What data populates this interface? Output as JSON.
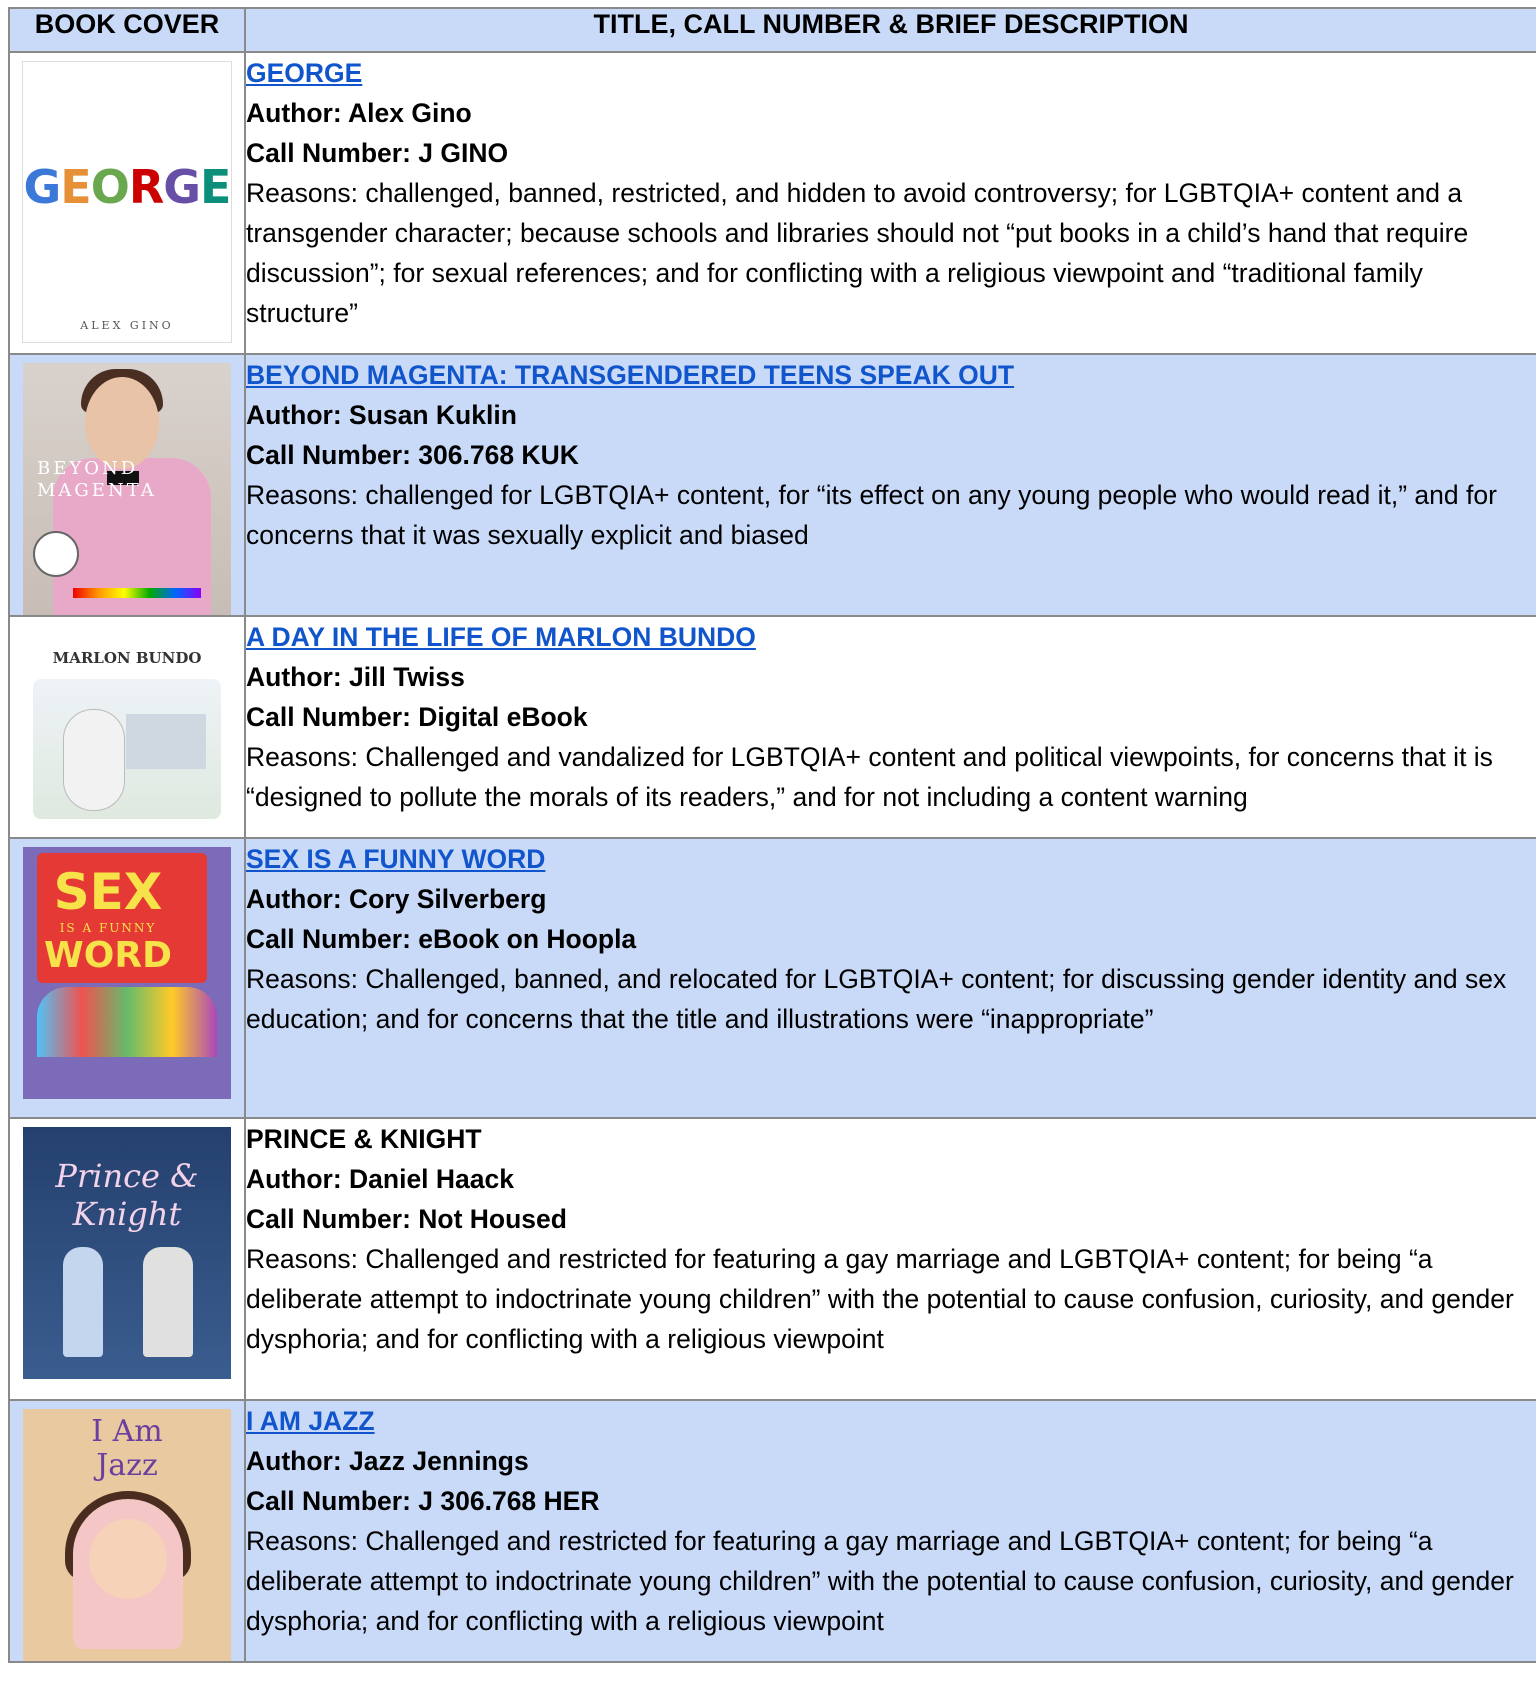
{
  "table": {
    "header_cover": "BOOK COVER",
    "header_desc": "TITLE, CALL NUMBER & BRIEF DESCRIPTION"
  },
  "books": [
    {
      "title": "GEORGE",
      "author": "Author: Alex Gino",
      "call": "Call Number: J GINO",
      "reasons": "Reasons: challenged, banned, restricted, and hidden to avoid controversy; for LGBTQIA+ content and a transgender character; because schools and libraries should not “put books in a child’s hand that require discussion”; for sexual references; and for conflicting with a religious viewpoint and “traditional family structure”",
      "cover_title": "GEORGE",
      "cover_author": "ALEX GINO"
    },
    {
      "title": "BEYOND MAGENTA: TRANSGENDERED TEENS SPEAK OUT",
      "author": "Author: Susan Kuklin",
      "call": "Call Number: 306.768 KUK",
      "reasons": "Reasons: challenged for LGBTQIA+ content, for “its effect on any young people who would read it,” and for concerns that it was sexually explicit and biased",
      "cover_line1": "BEYOND",
      "cover_line2": "MAGENTA"
    },
    {
      "title": "A DAY IN THE LIFE OF MARLON BUNDO",
      "author": "Author: Jill Twiss",
      "call": "Call Number: Digital eBook",
      "reasons": "Reasons: Challenged and vandalized for LGBTQIA+ content and political viewpoints, for concerns that it is “designed to pollute the morals of its readers,” and for not including a content warning",
      "cover_title": "MARLON BUNDO"
    },
    {
      "title": "SEX IS A FUNNY WORD",
      "author": "Author: Cory Silverberg",
      "call": "Call Number: eBook on Hoopla",
      "reasons": "Reasons: Challenged, banned, and relocated for LGBTQIA+ content; for discussing gender identity and sex education; and for concerns that the title and illustrations were “inappropriate”",
      "cover_w1": "SEX",
      "cover_w2": "IS A FUNNY",
      "cover_w3": "WORD"
    },
    {
      "title": "PRINCE & KNIGHT",
      "author": "Author: Daniel Haack",
      "call": "Call Number: Not Housed",
      "reasons": "Reasons: Challenged and restricted for featuring a gay marriage and LGBTQIA+ content; for being “a deliberate attempt to indoctrinate young children” with the potential to cause confusion, curiosity, and gender dysphoria; and for conflicting with a religious viewpoint",
      "cover_title": "Prince & Knight"
    },
    {
      "title": "I AM JAZZ",
      "author": "Author: Jazz Jennings",
      "call": "Call Number: J 306.768 HER",
      "reasons": "Reasons: Challenged and restricted for featuring a gay marriage and LGBTQIA+ content; for being “a deliberate attempt to indoctrinate young children” with the potential to cause confusion, curiosity, and gender dysphoria; and for conflicting with a religious viewpoint",
      "cover_title1": "I Am",
      "cover_title2": "Jazz"
    }
  ],
  "colors": {
    "header_bg": "#c9daf8",
    "alt_row_bg": "#c9daf8",
    "link": "#1155cc",
    "border": "#8a8a8a"
  }
}
